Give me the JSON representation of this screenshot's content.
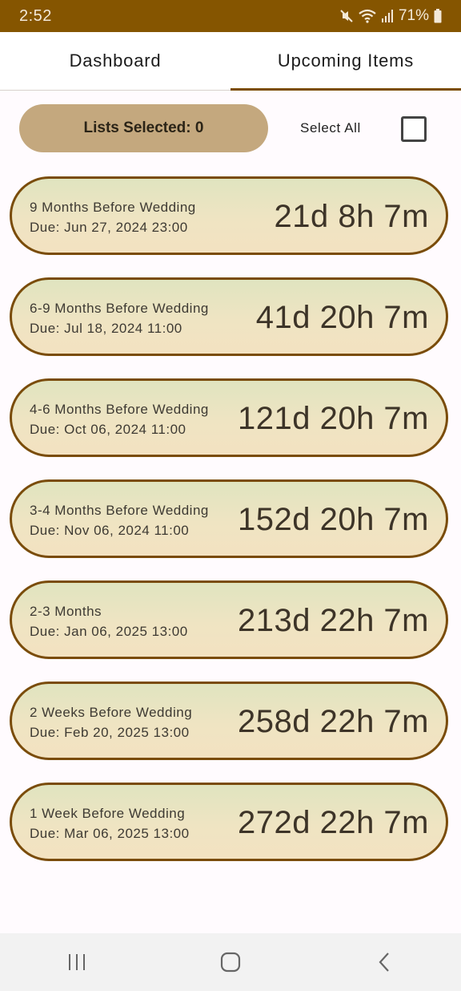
{
  "status_bar": {
    "time": "2:52",
    "battery": "71%",
    "icons": [
      "mute-icon",
      "wifi-icon",
      "signal-icon",
      "battery-icon"
    ]
  },
  "tabs": [
    {
      "label": "Dashboard",
      "active": false
    },
    {
      "label": "Upcoming Items",
      "active": true
    }
  ],
  "selection": {
    "lists_selected_label": "Lists Selected: 0",
    "select_all_label": "Select All",
    "select_all_checked": false
  },
  "cards": [
    {
      "title": "9 Months Before Wedding",
      "due": "Due: Jun 27, 2024 23:00",
      "countdown": "21d 8h 7m"
    },
    {
      "title": "6-9 Months Before Wedding",
      "due": "Due: Jul 18, 2024 11:00",
      "countdown": "41d 20h 7m"
    },
    {
      "title": "4-6 Months Before Wedding",
      "due": "Due: Oct 06, 2024 11:00",
      "countdown": "121d 20h 7m"
    },
    {
      "title": "3-4 Months Before Wedding",
      "due": "Due: Nov 06, 2024 11:00",
      "countdown": "152d 20h 7m"
    },
    {
      "title": "2-3 Months",
      "due": "Due: Jan 06, 2025 13:00",
      "countdown": "213d 22h 7m"
    },
    {
      "title": "2 Weeks Before Wedding",
      "due": "Due: Feb 20, 2025 13:00",
      "countdown": "258d 22h 7m"
    },
    {
      "title": "1 Week Before Wedding",
      "due": "Due: Mar 06, 2025 13:00",
      "countdown": "272d 22h 7m"
    }
  ],
  "nav_bar": {
    "icons": [
      "recent-apps-icon",
      "home-icon",
      "back-icon"
    ]
  },
  "colors": {
    "status_bar": "#855500",
    "accent": "#7a4c00",
    "button": "#c4a87e",
    "card_border": "#7a4c0a"
  }
}
